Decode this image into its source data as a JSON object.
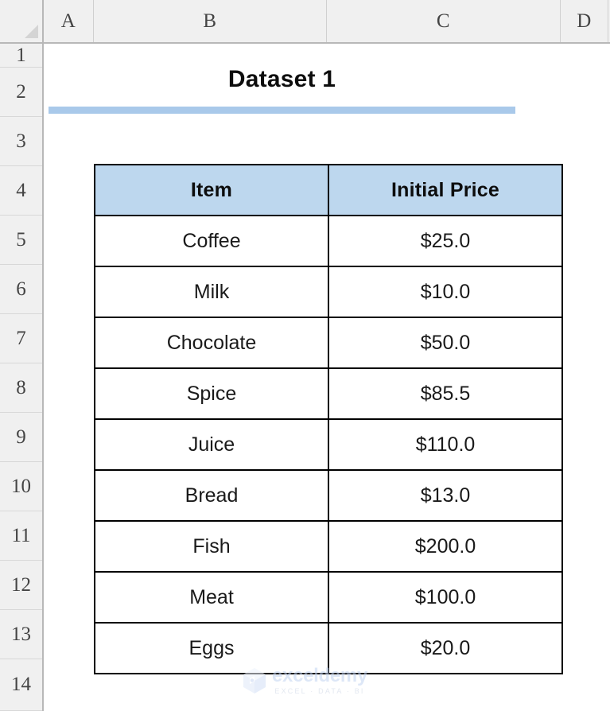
{
  "grid": {
    "column_headers": [
      "A",
      "B",
      "C",
      "D"
    ],
    "row_headers": [
      "1",
      "2",
      "3",
      "4",
      "5",
      "6",
      "7",
      "8",
      "9",
      "10",
      "11",
      "12",
      "13",
      "14"
    ],
    "select_all_icon": "select-all-triangle-icon"
  },
  "sheet": {
    "title": "Dataset 1",
    "accent_color": "#a9c9ea",
    "header_fill": "#bdd7ee",
    "border_color": "#000000"
  },
  "table": {
    "columns": [
      "Item",
      "Initial Price"
    ],
    "rows": [
      {
        "item": "Coffee",
        "price": "$25.0"
      },
      {
        "item": "Milk",
        "price": "$10.0"
      },
      {
        "item": "Chocolate",
        "price": "$50.0"
      },
      {
        "item": "Spice",
        "price": "$85.5"
      },
      {
        "item": "Juice",
        "price": "$110.0"
      },
      {
        "item": "Bread",
        "price": "$13.0"
      },
      {
        "item": "Fish",
        "price": "$200.0"
      },
      {
        "item": "Meat",
        "price": "$100.0"
      },
      {
        "item": "Eggs",
        "price": "$20.0"
      }
    ]
  },
  "watermark": {
    "icon": "exceldemy-cube-logo-icon",
    "name": "exceldemy",
    "tagline": "EXCEL · DATA · BI"
  }
}
